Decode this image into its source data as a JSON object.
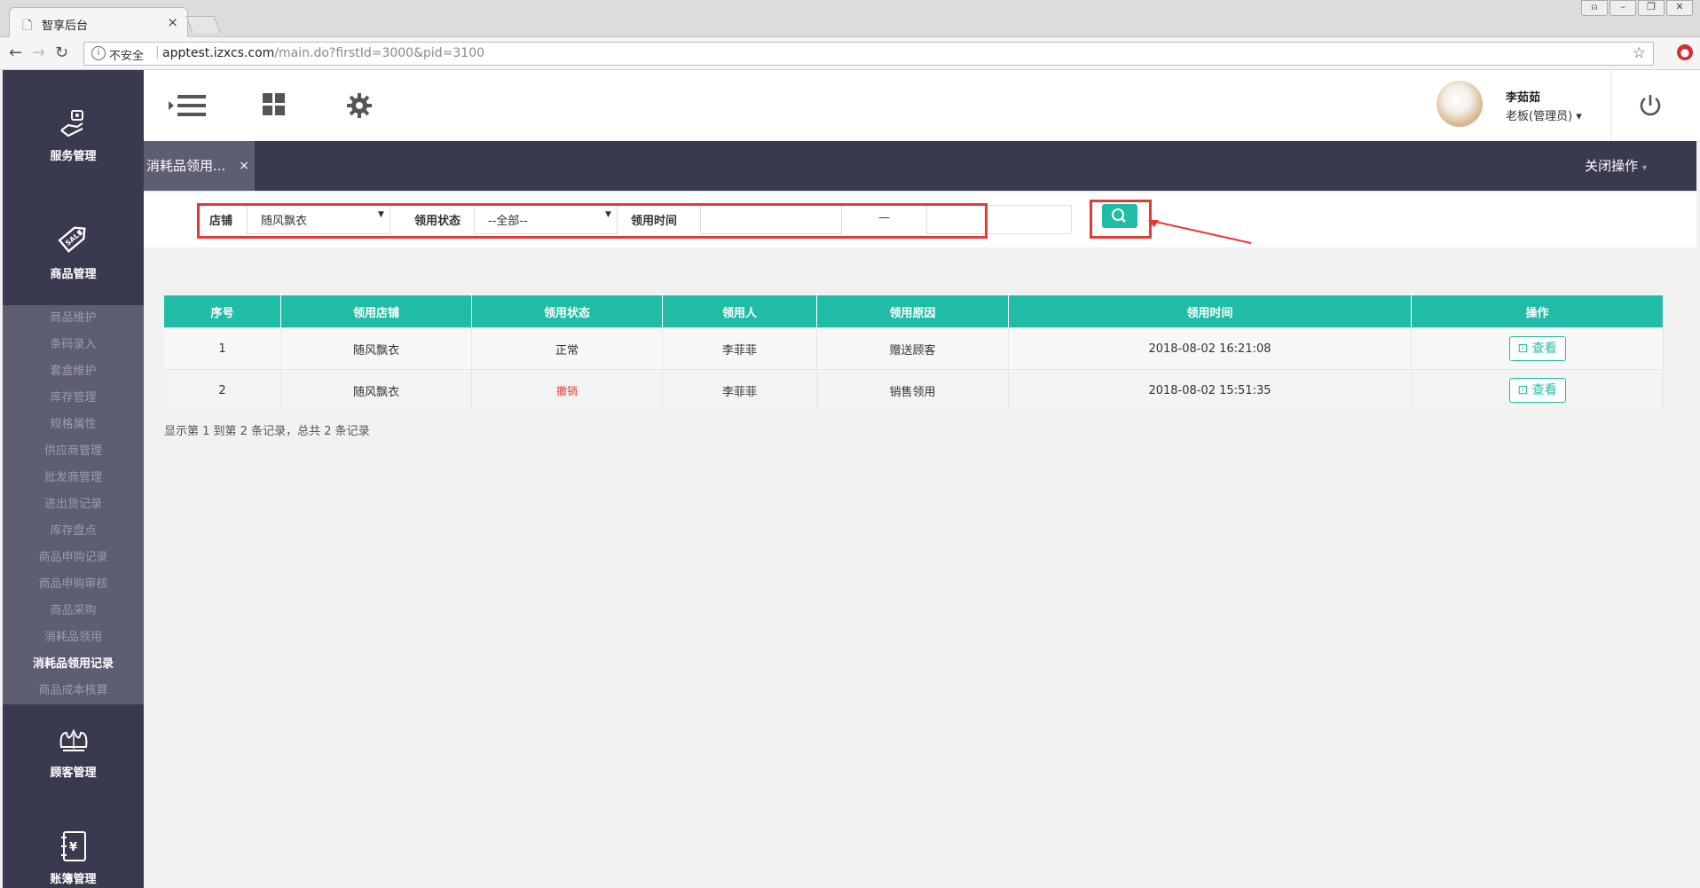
{
  "browser": {
    "tab_title": "智享后台",
    "tab_close": "×",
    "security_label": "不安全",
    "url_host": "apptest.izxcs.com",
    "url_path": "/main.do?firstId=3000&pid=3100"
  },
  "sidebar": {
    "sections": [
      {
        "label": "服务管理",
        "icon": "hand-service-icon"
      },
      {
        "label": "商品管理",
        "icon": "sale-tag-icon"
      },
      {
        "label": "顾客管理",
        "icon": "crown-icon"
      },
      {
        "label": "账簿管理",
        "icon": "ledger-icon"
      }
    ],
    "submenu": [
      "商品维护",
      "条码录入",
      "套盒维护",
      "库存管理",
      "规格属性",
      "供应商管理",
      "批发商管理",
      "进出货记录",
      "库存盘点",
      "商品申购记录",
      "商品申购审核",
      "商品采购",
      "消耗品领用",
      "消耗品领用记录",
      "商品成本核算"
    ],
    "active_item": "消耗品领用记录"
  },
  "header": {
    "user_name": "李茹茹",
    "user_role": "老板(管理员)"
  },
  "tabbar": {
    "page_tab": "消耗品领用...",
    "page_tab_close": "×",
    "close_ops": "关闭操作"
  },
  "filters": {
    "store_label": "店铺",
    "store_value": "随风飘衣",
    "status_label": "领用状态",
    "status_value": "--全部--",
    "time_label": "领用时间",
    "time_sep": "—",
    "time_start": "",
    "time_end": ""
  },
  "table": {
    "headers": [
      "序号",
      "领用店铺",
      "领用状态",
      "领用人",
      "领用原因",
      "领用时间",
      "操作"
    ],
    "rows": [
      {
        "no": "1",
        "store": "随风飘衣",
        "status": "正常",
        "person": "李菲菲",
        "reason": "赠送顾客",
        "time": "2018-08-02 16:21:08",
        "action": "查看"
      },
      {
        "no": "2",
        "store": "随风飘衣",
        "status": "撤销",
        "person": "李菲菲",
        "reason": "销售领用",
        "time": "2018-08-02 15:51:35",
        "action": "查看"
      }
    ]
  },
  "pagination": {
    "summary": "显示第 1 到第 2 条记录，总共 2 条记录"
  },
  "colors": {
    "accent": "#21bca6",
    "sidebar_bg": "#393a50",
    "submenu_bg": "#5d5e72",
    "annotation": "#e53935"
  }
}
